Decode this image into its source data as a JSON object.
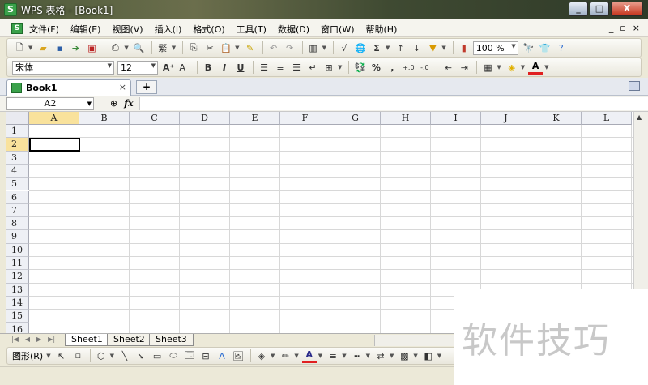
{
  "window": {
    "app_icon": "S",
    "title": "WPS 表格 - [Book1]",
    "controls": [
      "_",
      "□",
      "X"
    ]
  },
  "menu": {
    "items": [
      "文件(F)",
      "编辑(E)",
      "视图(V)",
      "插入(I)",
      "格式(O)",
      "工具(T)",
      "数据(D)",
      "窗口(W)",
      "帮助(H)"
    ],
    "mdi_controls": [
      "_",
      "▫",
      "×"
    ]
  },
  "toolbar": {
    "zoom": "100 %",
    "font_name": "宋体",
    "font_size": "12",
    "bold": "B",
    "italic": "I",
    "underline": "U",
    "percent": "%",
    "comma": ",",
    "sum": "Σ",
    "font_color": "A"
  },
  "tabs": {
    "doc_name": "Book1",
    "close": "×",
    "new_tab": "+"
  },
  "formula_bar": {
    "name_box": "A2",
    "fx": "fx",
    "value": ""
  },
  "grid": {
    "columns": [
      "A",
      "B",
      "C",
      "D",
      "E",
      "F",
      "G",
      "H",
      "I",
      "J",
      "K",
      "L"
    ],
    "rows": [
      "1",
      "2",
      "3",
      "4",
      "5",
      "6",
      "7",
      "8",
      "9",
      "10",
      "11",
      "12",
      "13",
      "14",
      "15",
      "16"
    ],
    "active_cell": "A2",
    "active_column": "A",
    "active_row": "2"
  },
  "sheets": [
    "Sheet1",
    "Sheet2",
    "Sheet3"
  ],
  "active_sheet": "Sheet1",
  "draw_toolbar": {
    "label": "图形(R)"
  },
  "watermark": "软件技巧",
  "colors": {
    "selection_header": "#f9e29c",
    "grid_line": "#d8d8d8",
    "font_color_bar": "#e02020"
  }
}
